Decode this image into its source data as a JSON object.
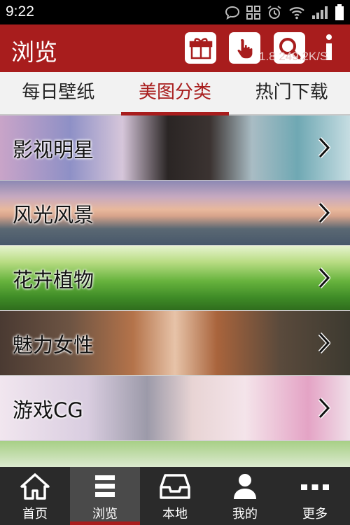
{
  "status_bar": {
    "time": "9:22"
  },
  "header": {
    "title": "浏览",
    "speed_text": "1.8 249.2K/S",
    "buttons": {
      "gift": "gift-icon",
      "hand": "hand-pointer-icon",
      "search": "search-icon",
      "more": "more-vertical-icon"
    },
    "accent_color": "#a81d1d"
  },
  "tabs": [
    {
      "label": "每日壁纸",
      "active": false
    },
    {
      "label": "美图分类",
      "active": true
    },
    {
      "label": "热门下载",
      "active": false
    }
  ],
  "categories": [
    {
      "label": "影视明星"
    },
    {
      "label": "风光风景"
    },
    {
      "label": "花卉植物"
    },
    {
      "label": "魅力女性"
    },
    {
      "label": "游戏CG"
    },
    {
      "label": ""
    }
  ],
  "bottom_nav": [
    {
      "label": "首页",
      "icon": "home-icon",
      "active": false
    },
    {
      "label": "浏览",
      "icon": "list-icon",
      "active": true
    },
    {
      "label": "本地",
      "icon": "tray-icon",
      "active": false
    },
    {
      "label": "我的",
      "icon": "person-icon",
      "active": false
    },
    {
      "label": "更多",
      "icon": "more-horizontal-icon",
      "active": false
    }
  ]
}
